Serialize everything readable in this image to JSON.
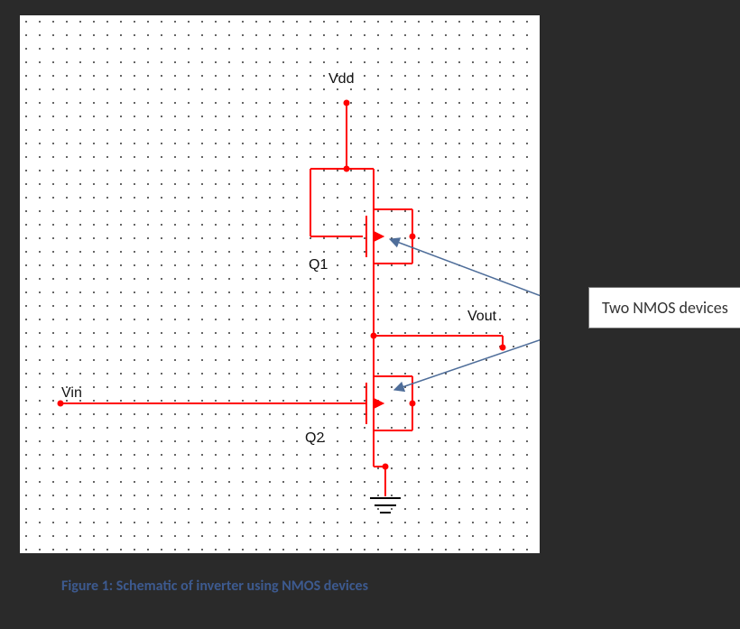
{
  "labels": {
    "vdd": "Vdd",
    "vout": "Vout",
    "vin": "Vin",
    "q1": "Q1",
    "q2": "Q2"
  },
  "annotation": "Two NMOS devices",
  "caption": "Figure 1: Schematic of inverter using NMOS devices",
  "colors": {
    "wire": "#ff0000",
    "arrow": "#4f6e9a",
    "text": "#111",
    "caption": "#3d5a8f"
  },
  "schematic": {
    "type": "NMOS inverter",
    "devices": [
      {
        "name": "Q1",
        "type": "NMOS",
        "role": "load (diode-connected)",
        "gate": "Vdd",
        "drain": "Vdd",
        "source": "Vout"
      },
      {
        "name": "Q2",
        "type": "NMOS",
        "role": "driver",
        "gate": "Vin",
        "drain": "Vout",
        "source": "GND"
      }
    ],
    "nets": [
      "Vdd",
      "Vin",
      "Vout",
      "GND"
    ]
  }
}
